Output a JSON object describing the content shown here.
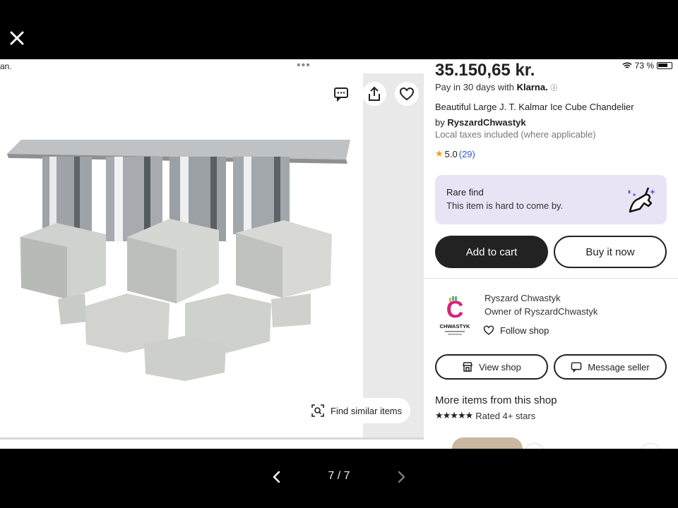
{
  "viewer": {
    "close_icon": "close-icon",
    "counter": "7 / 7",
    "prev_icon": "chevron-left-icon",
    "next_icon": "chevron-right-icon"
  },
  "left": {
    "truncated_text": "an.",
    "more_icon": "more-dots-icon",
    "find_similar_label": "Find similar items",
    "icons": [
      "chat-icon",
      "share-icon",
      "heart-icon",
      "visual-search-icon"
    ]
  },
  "status": {
    "battery_percent": "73 %"
  },
  "listing": {
    "price": "35.150,65 kr.",
    "klarna_prefix": "Pay in 30 days with",
    "klarna_brand": "Klarna.",
    "title": "Beautiful Large J. T. Kalmar Ice Cube Chandelier",
    "by_prefix": "by",
    "shop_handle": "RyszardChwastyk",
    "taxes": "Local taxes included (where applicable)",
    "rating": "5.0",
    "reviews": "(29)"
  },
  "rare": {
    "title": "Rare find",
    "subtitle": "This item is hard to come by."
  },
  "actions": {
    "add_to_cart": "Add to cart",
    "buy_now": "Buy it now"
  },
  "shop": {
    "logo_letter": "C",
    "logo_text": "CHWASTYK",
    "owner_name": "Ryszard Chwastyk",
    "owner_role": "Owner of RyszardChwastyk",
    "follow_label": "Follow shop",
    "view_shop": "View shop",
    "message_seller": "Message seller"
  },
  "more": {
    "title": "More items from this shop",
    "stars_label": "Rated 4+ stars"
  },
  "colors": {
    "rare_bg": "#e8e3f5",
    "primary_btn": "#222222",
    "rating_star": "#e8a317",
    "review_link": "#2a5cd0"
  }
}
